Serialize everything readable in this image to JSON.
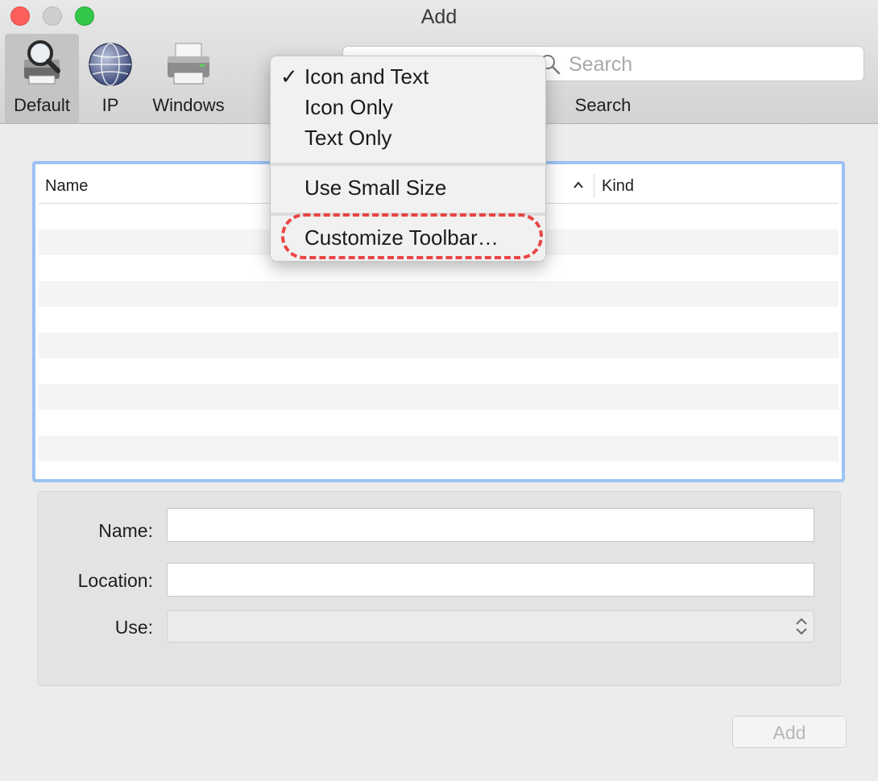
{
  "window": {
    "title": "Add"
  },
  "toolbar": {
    "items": [
      {
        "label": "Default",
        "icon": "printer-magnifier-icon",
        "selected": true
      },
      {
        "label": "IP",
        "icon": "globe-icon",
        "selected": false
      },
      {
        "label": "Windows",
        "icon": "printer-icon",
        "selected": false
      }
    ],
    "search": {
      "placeholder": "Search",
      "label": "Search"
    }
  },
  "table": {
    "columns": [
      {
        "label": "Name"
      },
      {
        "label": "Kind"
      }
    ],
    "sort_icon": "chevron-up-icon",
    "rows": []
  },
  "form": {
    "name_label": "Name:",
    "name_value": "",
    "location_label": "Location:",
    "location_value": "",
    "use_label": "Use:",
    "use_value": ""
  },
  "add_button": {
    "label": "Add",
    "enabled": false
  },
  "context_menu": {
    "items": [
      {
        "label": "Icon and Text",
        "checked": true
      },
      {
        "label": "Icon Only",
        "checked": false
      },
      {
        "label": "Text Only",
        "checked": false
      },
      {
        "label": "Use Small Size",
        "checked": false
      },
      {
        "label": "Customize Toolbar…",
        "checked": false,
        "highlighted": true
      }
    ],
    "check_glyph": "✓"
  },
  "colors": {
    "highlight_ring": "#ea3333",
    "table_focus": "#9cc2f2",
    "close": "#fc605c",
    "zoom": "#34c84a"
  }
}
